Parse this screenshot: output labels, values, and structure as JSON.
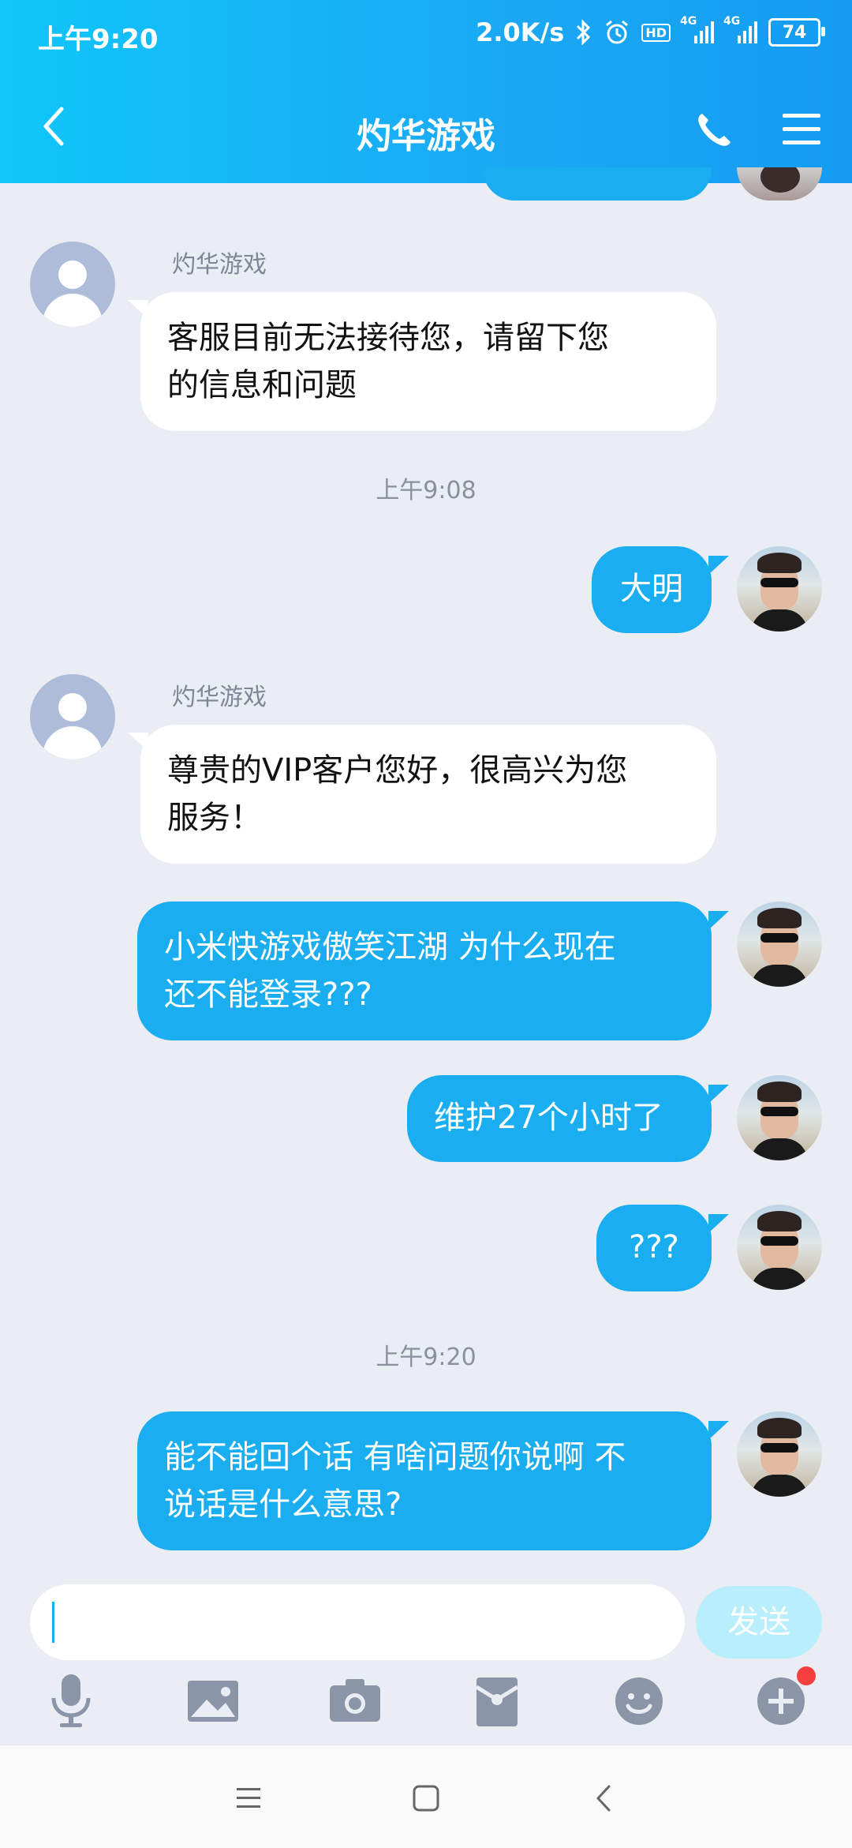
{
  "status_bar": {
    "time": "上午9:20",
    "net_speed": "2.0K/s",
    "battery": "74",
    "net_labels": [
      "4G",
      "4G"
    ],
    "icons": [
      "bluetooth-icon",
      "alarm-icon",
      "hd-icon",
      "signal-icon",
      "signal-icon",
      "battery-icon"
    ]
  },
  "header": {
    "title": "灼华游戏",
    "back_icon": "chevron-left-icon",
    "phone_icon": "phone-icon",
    "menu_icon": "menu-icon"
  },
  "messages": [
    {
      "type": "incoming",
      "sender": "灼华游戏",
      "lines": [
        "客服目前无法接待您，请留下您",
        "的信息和问题"
      ]
    },
    {
      "type": "timestamp",
      "text": "上午9:08"
    },
    {
      "type": "outgoing",
      "lines": [
        "大明"
      ]
    },
    {
      "type": "incoming",
      "sender": "灼华游戏",
      "lines": [
        "尊贵的VIP客户您好，很高兴为您",
        "服务！"
      ]
    },
    {
      "type": "outgoing",
      "lines": [
        "小米快游戏傲笑江湖 为什么现在",
        "还不能登录???"
      ]
    },
    {
      "type": "outgoing",
      "lines": [
        "维护27个小时了"
      ]
    },
    {
      "type": "outgoing",
      "lines": [
        "???"
      ]
    },
    {
      "type": "timestamp",
      "text": "上午9:20"
    },
    {
      "type": "outgoing",
      "lines": [
        "能不能回个话 有啥问题你说啊 不",
        "说话是什么意思?"
      ]
    }
  ],
  "input": {
    "value": "",
    "send_label": "发送"
  },
  "toolbar": [
    "mic-icon",
    "image-icon",
    "camera-icon",
    "red-envelope-icon",
    "emoji-icon",
    "plus-icon"
  ],
  "colors": {
    "accent": "#1aaef0",
    "header": "#10c6fa",
    "background": "#eaedf4",
    "badge": "#f63f3f"
  }
}
